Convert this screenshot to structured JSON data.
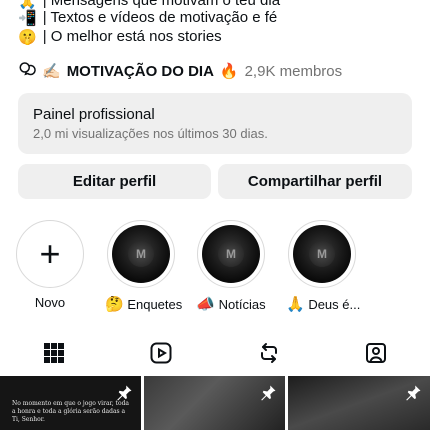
{
  "bio": {
    "lines": [
      {
        "emoji": "🙏",
        "text": "| Mensagens que motivam o teu dia"
      },
      {
        "emoji": "📲",
        "text": "| Textos e vídeos de motivação e fé"
      },
      {
        "emoji": "🤫",
        "text": "| O melhor está nos stories"
      }
    ]
  },
  "channel": {
    "name": "MOTIVAÇÃO DO DIA",
    "pre_emoji": "✍🏻",
    "post_emoji": "🔥",
    "members": "2,9K membros"
  },
  "dashboard": {
    "title": "Painel profissional",
    "subtitle": "2,0 mi visualizações nos últimos 30 dias."
  },
  "actions": {
    "edit": "Editar perfil",
    "share": "Compartilhar perfil"
  },
  "highlights": {
    "new_label": "Novo",
    "items": [
      {
        "emoji": "🤔",
        "label": "Enquetes"
      },
      {
        "emoji": "📣",
        "label": "Notícias"
      },
      {
        "emoji": "🙏",
        "label": "Deus é..."
      }
    ],
    "cover_letter": "M"
  },
  "tabs": [
    "grid-icon",
    "reels-icon",
    "reposts-icon",
    "tagged-icon"
  ],
  "posts": [
    {
      "text": "No momento em que o jogo virar, toda a honra e toda a glória serão dadas a Ti, Senhor.",
      "pinned": true
    },
    {
      "pinned": true
    },
    {
      "pinned": true
    }
  ],
  "colors": {
    "text": "#0c1014",
    "muted": "#737373",
    "button_bg": "#efefef"
  }
}
